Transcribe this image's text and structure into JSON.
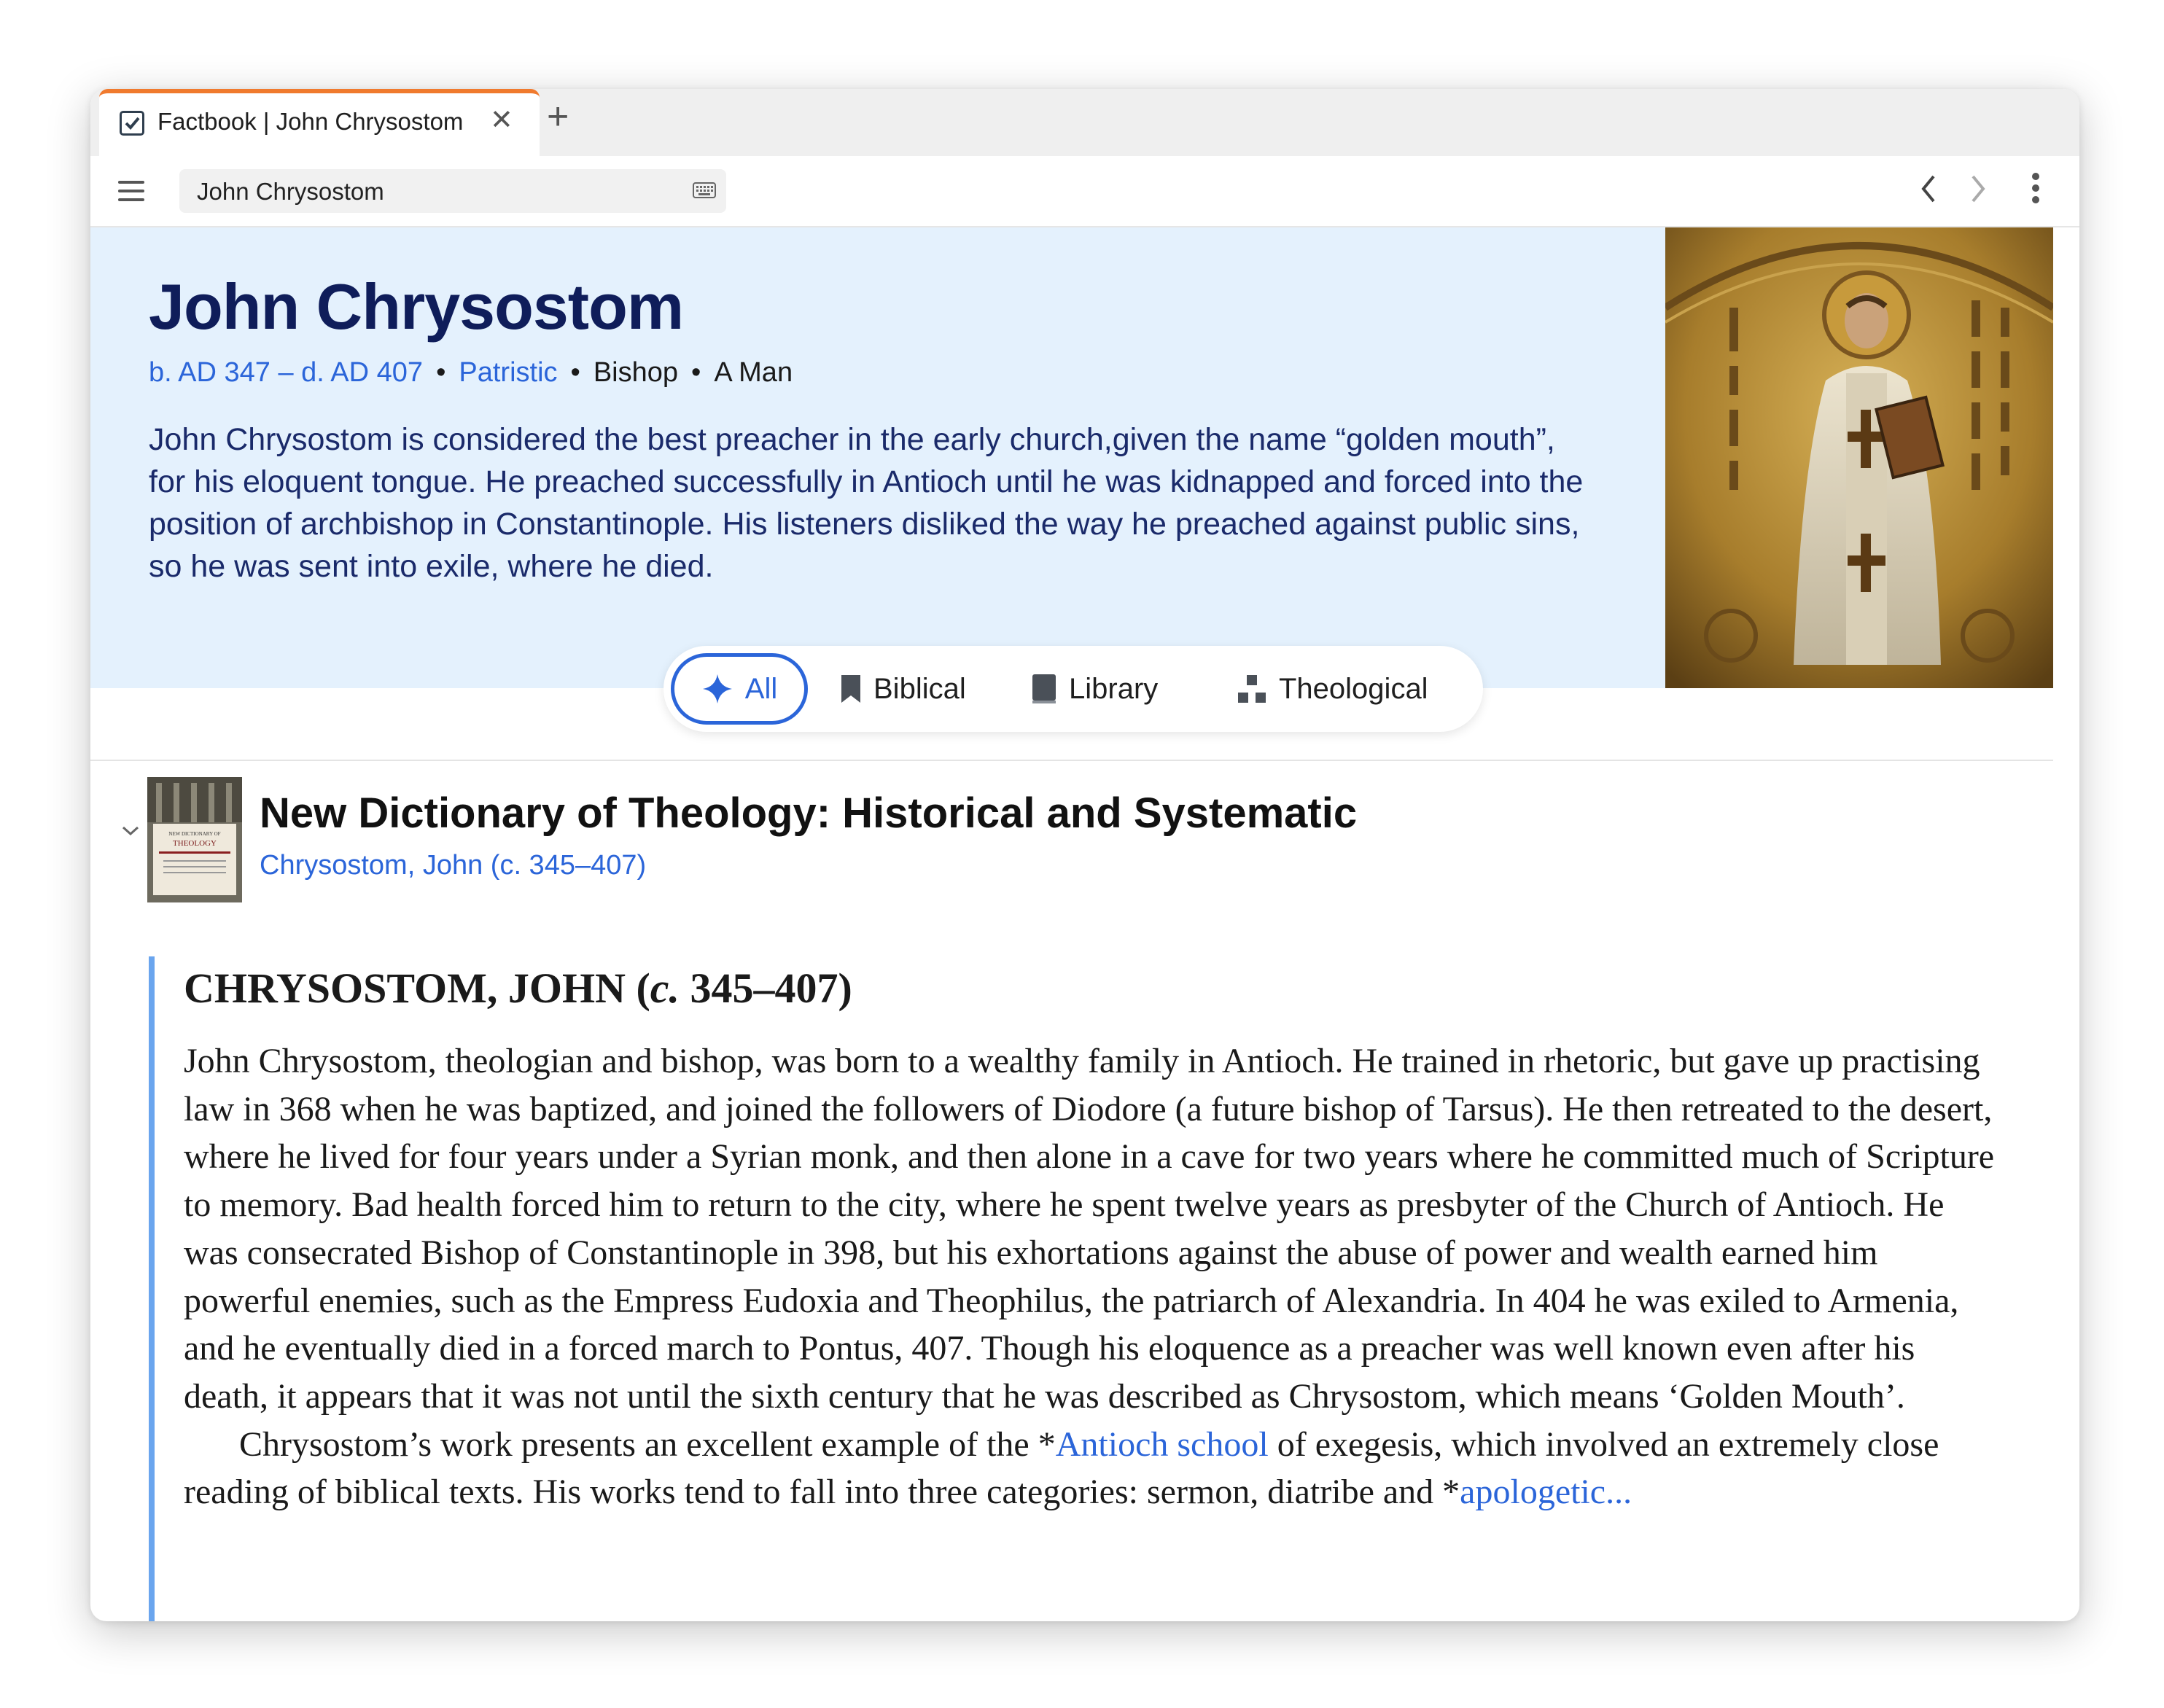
{
  "tab": {
    "title": "Factbook | John Chrysostom",
    "close": "✕",
    "new": "+"
  },
  "search": {
    "value": "John Chrysostom"
  },
  "entity": {
    "name": "John Chrysostom",
    "dates": "b. AD 347 – d. AD 407",
    "era": "Patristic",
    "role": "Bishop",
    "kind": "A Man",
    "separator": "•",
    "description": "John Chrysostom is considered the best preacher in the early church,given the name “golden mouth”, for his eloquent tongue. He preached successfully in Antioch until he was kidnapped and forced into the position of archbishop in Constantinople. His listeners disliked the way he preached against public sins, so he was sent into exile, where he died."
  },
  "filters": [
    {
      "label": "All",
      "icon": "sparkle-icon",
      "active": true
    },
    {
      "label": "Biblical",
      "icon": "bookmark-icon",
      "active": false
    },
    {
      "label": "Library",
      "icon": "book-icon",
      "active": false
    },
    {
      "label": "Theological",
      "icon": "blocks-icon",
      "active": false
    }
  ],
  "resource": {
    "title": "New Dictionary of Theology: Historical and Systematic",
    "subtitle": "Chrysostom, John (c. 345–407)",
    "cover_text": {
      "line1": "NEW DICTIONARY OF",
      "line2": "THEOLOGY"
    }
  },
  "article": {
    "heading_pre": "CHRYSOSTOM, JOHN (",
    "heading_italic": "c.",
    "heading_post": " 345–407)",
    "paragraph1": "John Chrysostom, theologian and bishop, was born to a wealthy family in Antioch. He trained in rhetoric, but gave up practising law in 368 when he was baptized, and joined the followers of Diodore (a future bishop of Tarsus). He then retreated to the desert, where he lived for four years under a Syrian monk, and then alone in a cave for two years where he committed much of Scripture to memory. Bad health forced him to return to the city, where he spent twelve years as presbyter of the Church of Antioch. He was consecrated Bishop of Constantinople in 398, but his exhortations against the abuse of power and wealth earned him powerful enemies, such as the Empress Eudoxia and Theophilus, the patriarch of Alexandria. In 404 he was exiled to Armenia, and he eventually died in a forced march to Pontus, 407. Though his eloquence as a preacher was well known even after his death, it appears that it was not until the sixth century that he was described as Chrysostom, which means ‘Golden Mouth’.",
    "p2_a": "Chrysostom’s work presents an excellent example of the *",
    "p2_link1": "Antioch school",
    "p2_b": " of exegesis, which involved an extremely close reading of biblical texts. His works tend to fall into three categories: sermon, diatribe and *",
    "p2_link2": "apologetic..."
  },
  "colors": {
    "accent": "#2b65d9",
    "hero_bg": "#e4f1fd",
    "tab_accent": "#f07a2e",
    "name": "#0f1d5a",
    "quote_bar": "#6aa5ee"
  }
}
